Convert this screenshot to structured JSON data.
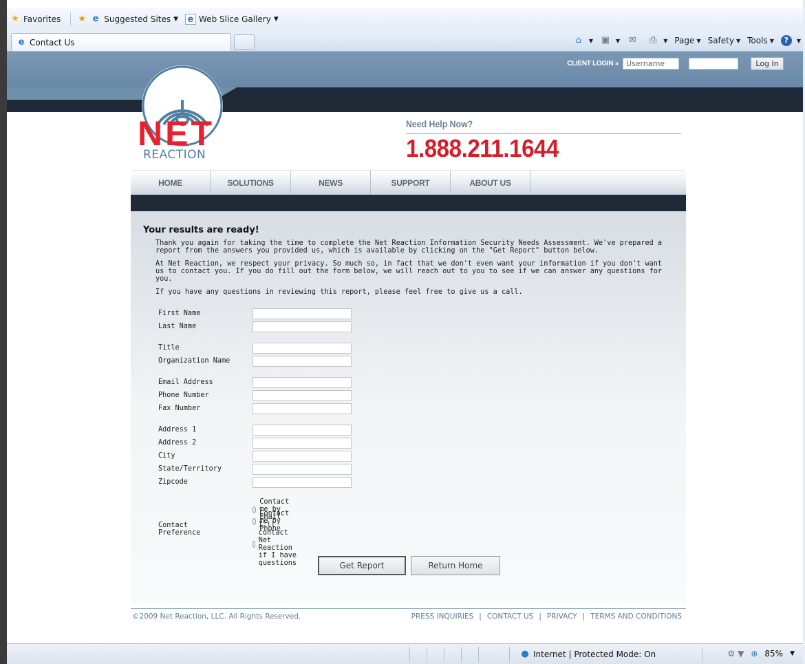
{
  "browser": {
    "favorites_label": "Favorites",
    "suggested_sites": "Suggested Sites",
    "web_slice_gallery": "Web Slice Gallery",
    "tab_title": "Contact Us",
    "cmd_page": "Page",
    "cmd_safety": "Safety",
    "cmd_tools": "Tools",
    "status_zone": "Internet | Protected Mode: On",
    "zoom": "85%"
  },
  "header": {
    "client_login_label": "CLIENT LOGIN",
    "username_placeholder": "Username",
    "login_button": "Log In",
    "logo_net": "NET",
    "logo_reaction": "REACTION",
    "help_label": "Need Help Now?",
    "phone": "1.888.211.1644"
  },
  "nav": {
    "items": [
      "HOME",
      "SOLUTIONS",
      "NEWS",
      "SUPPORT",
      "ABOUT US"
    ]
  },
  "main": {
    "heading": "Your results are ready!",
    "para1": "Thank you again for taking the time to complete the Net Reaction Information Security Needs Assessment. We've prepared a report from the answers you provided us, which is available by clicking on the \"Get Report\" button below.",
    "para2": "At Net Reaction, we respect your privacy. So much so, in fact that we don't even want your information if you don't want us to contact you. If you do fill out the form below, we will reach out to you to see if we can answer any questions for you.",
    "para3": "If you have any questions in reviewing this report, please feel free to give us a call."
  },
  "form": {
    "fields": {
      "first_name": "First Name",
      "last_name": "Last Name",
      "title": "Title",
      "organization_name": "Organization Name",
      "email_address": "Email Address",
      "phone_number": "Phone Number",
      "fax_number": "Fax Number",
      "address1": "Address 1",
      "address2": "Address 2",
      "city": "City",
      "state": "State/Territory",
      "zipcode": "Zipcode"
    },
    "contact_preference_label": "Contact Preference",
    "options": {
      "email": "Contact me by Email",
      "phone": "Contact me by Phone",
      "self": "I'll contact Net Reaction if I have questions"
    },
    "get_report": "Get Report",
    "return_home": "Return Home"
  },
  "footer": {
    "copyright": "©2009 Net Reaction, LLC. All Rights Reserved.",
    "links": [
      "PRESS INQUIRIES",
      "CONTACT US",
      "PRIVACY",
      "TERMS AND CONDITIONS"
    ],
    "separator": "|"
  },
  "colors": {
    "brand_red": "#e8202f",
    "brand_blue": "#4f7fa3",
    "header_blue": "#6f8faa",
    "header_dark": "#1e2a38"
  }
}
